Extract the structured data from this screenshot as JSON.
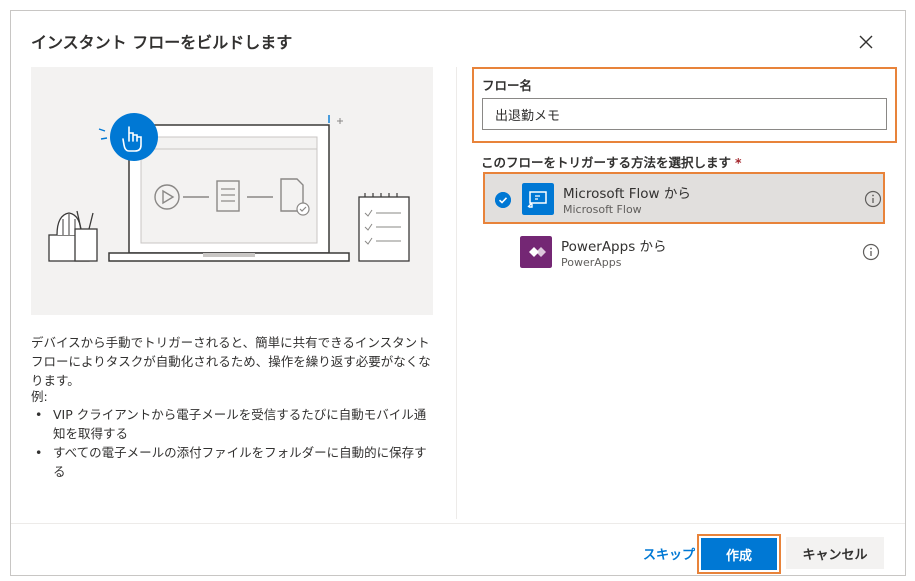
{
  "dialog": {
    "title": "インスタント フローをビルドします",
    "description": "デバイスから手動でトリガーされると、簡単に共有できるインスタント フローによりタスクが自動化されるため、操作を繰り返す必要がなくなります。",
    "example_label": "例:",
    "bullets": [
      "VIP クライアントから電子メールを受信するたびに自動モバイル通知を取得する",
      "すべての電子メールの添付ファイルをフォルダーに自動的に保存する"
    ],
    "bullet_glyph": "•"
  },
  "form": {
    "flow_name_label": "フロー名",
    "flow_name_value": "出退勤メモ",
    "trigger_label": "このフローをトリガーする方法を選択します",
    "required_mark": "*",
    "options": [
      {
        "name": "Microsoft Flow から",
        "sub": "Microsoft Flow",
        "icon": "microsoft-flow-icon",
        "color": "#0078d4",
        "selected": true
      },
      {
        "name": "PowerApps から",
        "sub": "PowerApps",
        "icon": "powerapps-icon",
        "color": "#742774",
        "selected": false
      }
    ]
  },
  "footer": {
    "skip_label": "スキップ",
    "create_label": "作成",
    "cancel_label": "キャンセル"
  },
  "colors": {
    "accent": "#0078d4",
    "highlight": "#e8833a"
  }
}
